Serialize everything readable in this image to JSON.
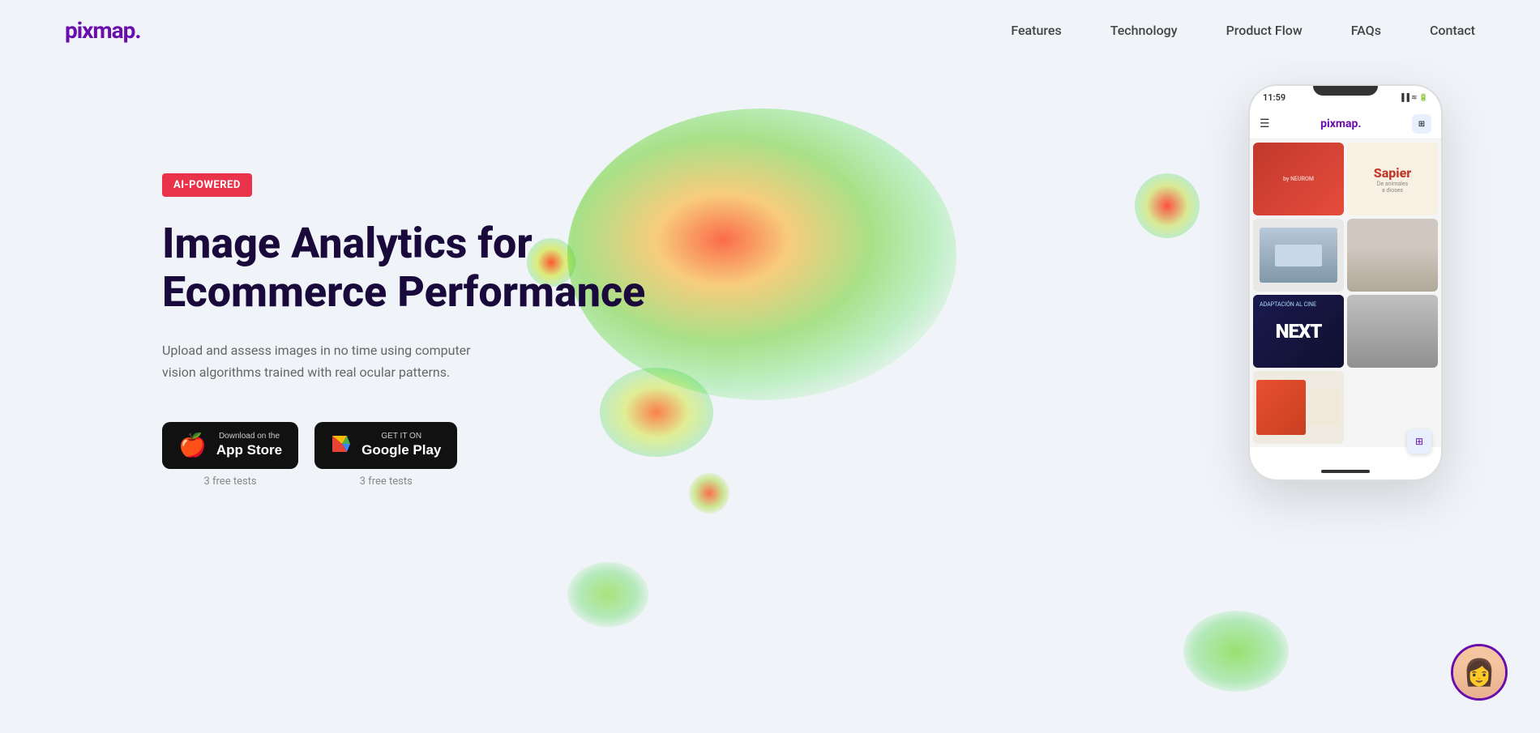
{
  "navbar": {
    "logo": "pixmap.",
    "links": [
      {
        "label": "Features",
        "id": "features"
      },
      {
        "label": "Technology",
        "id": "technology"
      },
      {
        "label": "Product Flow",
        "id": "product-flow"
      },
      {
        "label": "FAQs",
        "id": "faqs"
      },
      {
        "label": "Contact",
        "id": "contact"
      }
    ]
  },
  "hero": {
    "badge": "AI-POWERED",
    "title_line1": "Image Analytics for",
    "title_line2": "Ecommerce Performance",
    "description": "Upload and assess images in no time using computer vision algorithms trained with real ocular patterns.",
    "app_store": {
      "sub": "Download on the",
      "main": "App Store",
      "free_tests": "3 free tests"
    },
    "google_play": {
      "sub": "GET IT ON",
      "main": "Google Play",
      "free_tests": "3 free tests"
    }
  },
  "phone": {
    "time": "11:59",
    "logo": "pixmap."
  }
}
